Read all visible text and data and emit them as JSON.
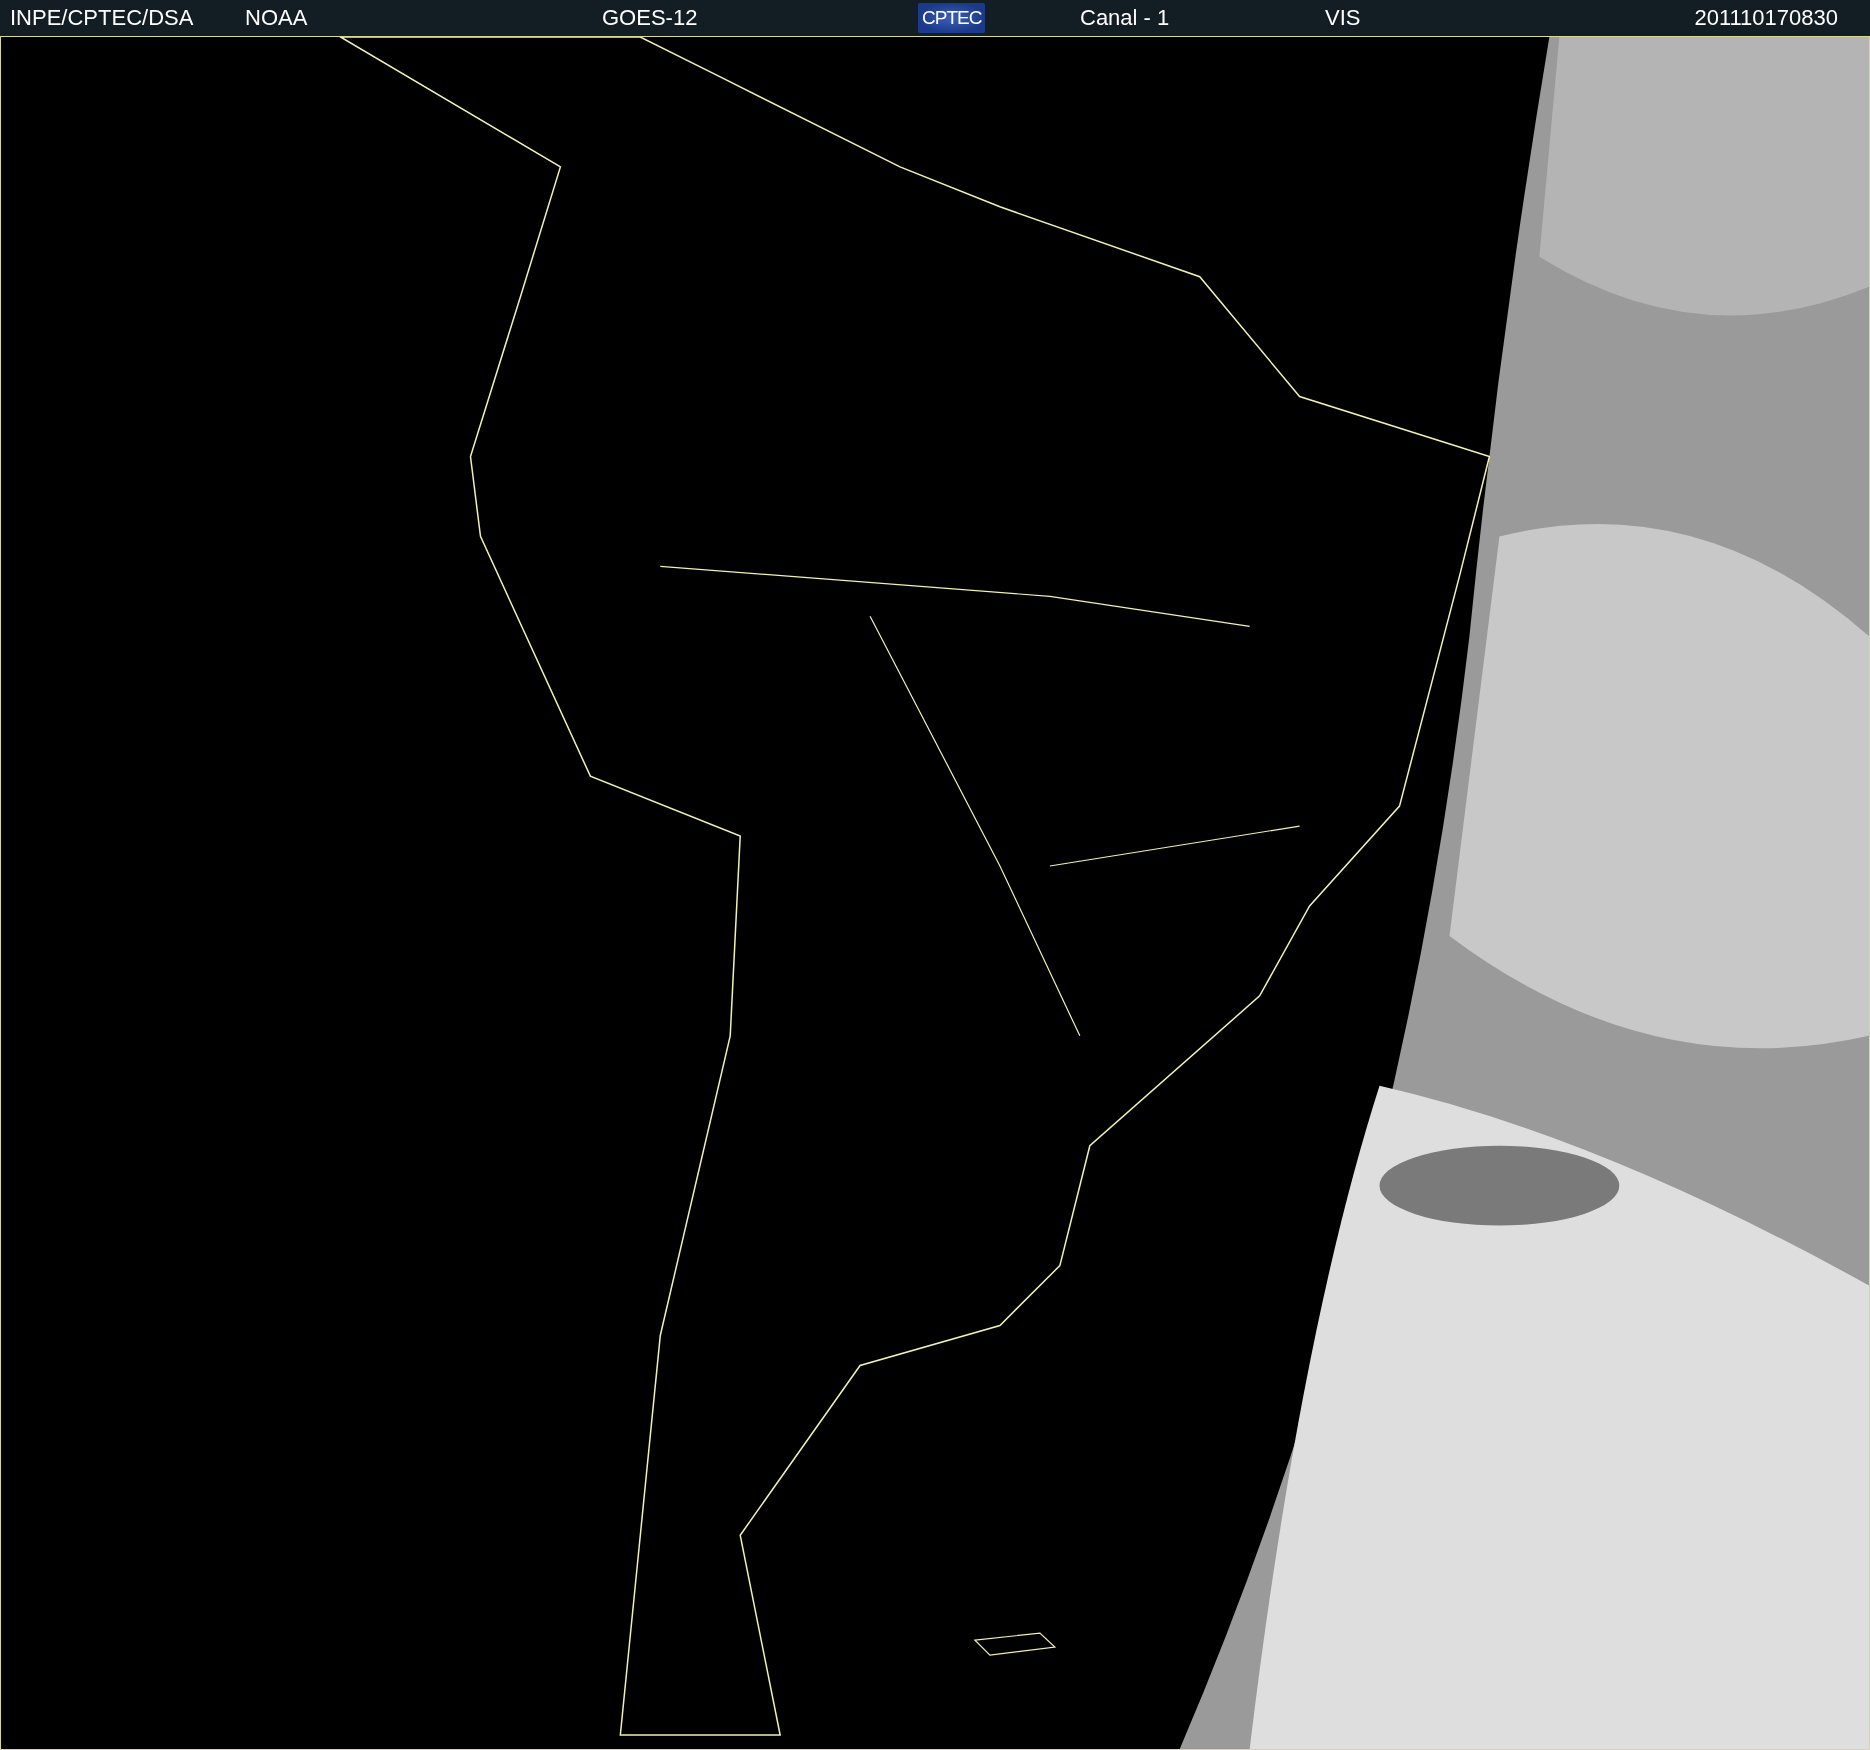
{
  "header": {
    "labels": [
      "INPE/CPTEC/DSA",
      "NOAA",
      "GOES-12"
    ],
    "logo": "CPTEC",
    "channel": "Canal - 1",
    "band": "VIS",
    "timestamp": "201110170830"
  }
}
